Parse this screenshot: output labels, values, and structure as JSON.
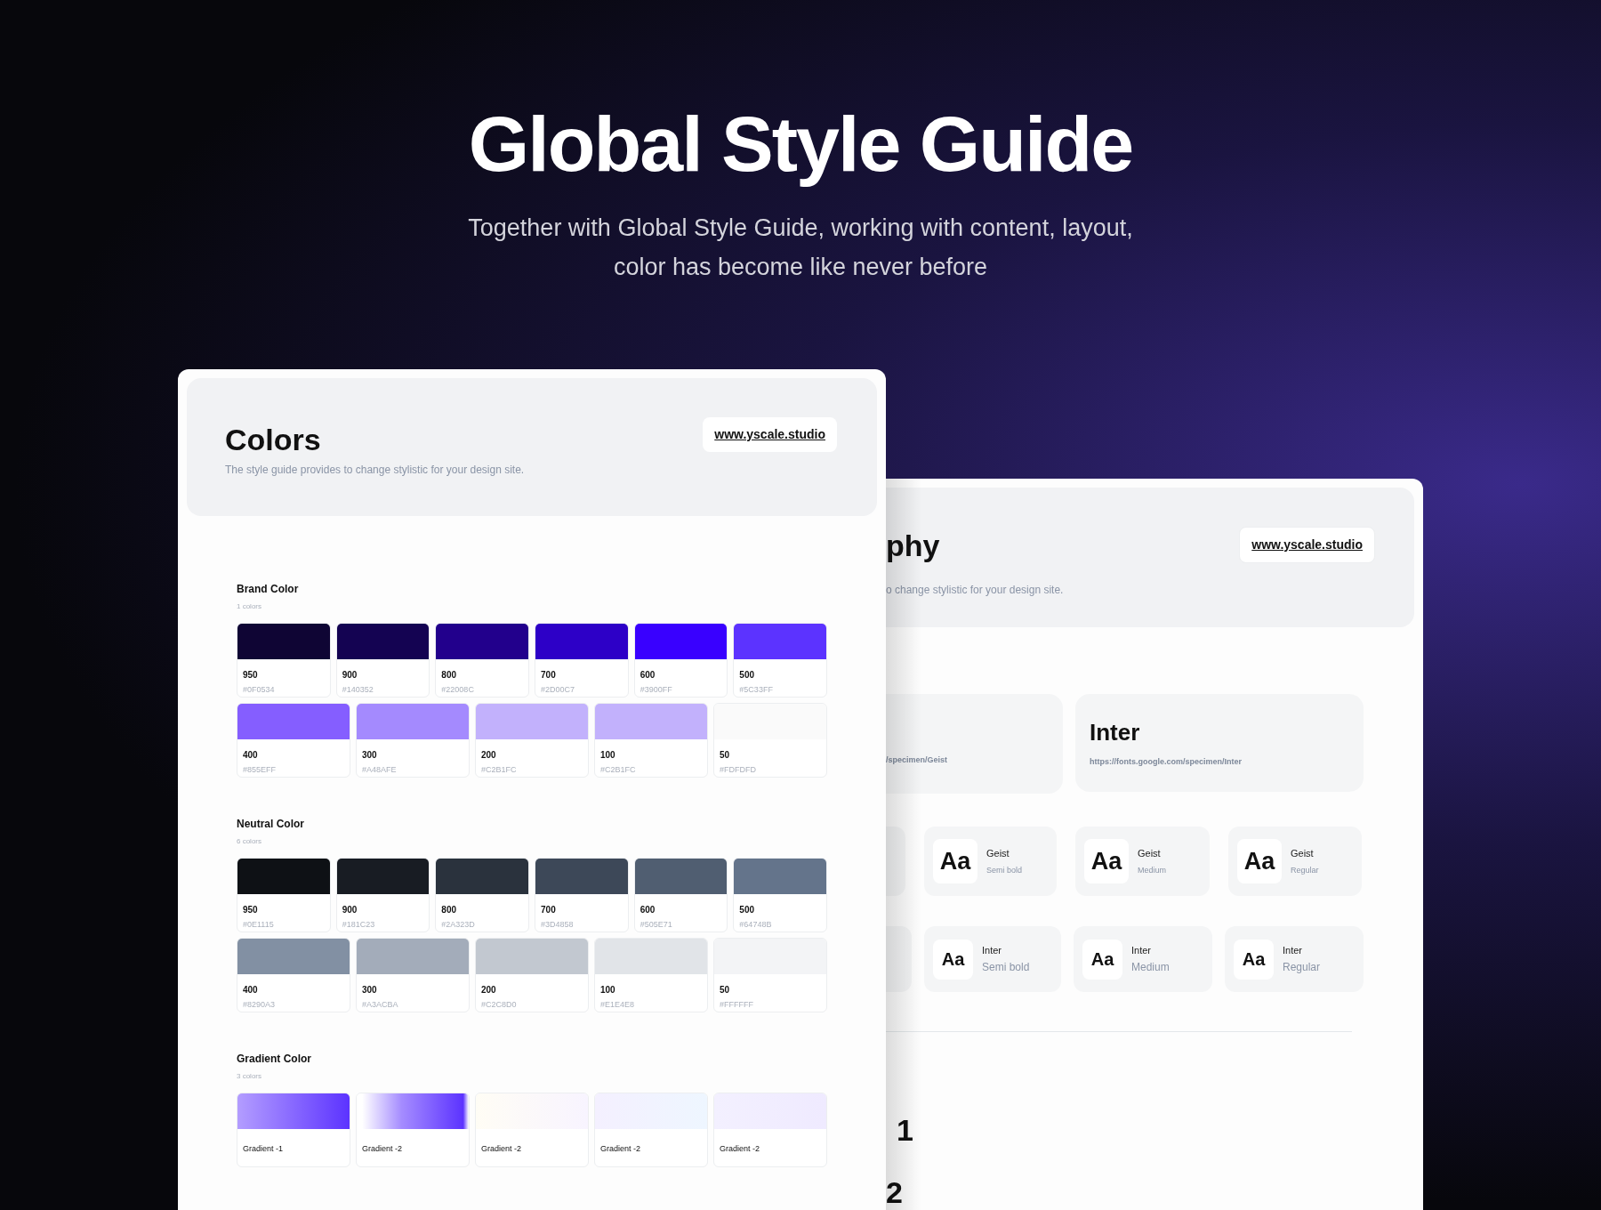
{
  "hero": {
    "title": "Global Style Guide",
    "subtitle": "Together with Global Style Guide, working with content, layout, color has become like never before"
  },
  "colors_page": {
    "title": "Colors",
    "link": "www.yscale.studio",
    "description": "The style guide provides to change stylistic for your design site.",
    "sections": [
      {
        "title": "Brand Color",
        "count": "1 colors",
        "kind": "solid",
        "rows": [
          [
            {
              "name": "950",
              "hex": "#0F0534",
              "color": "#0f0534"
            },
            {
              "name": "900",
              "hex": "#140352",
              "color": "#140352"
            },
            {
              "name": "800",
              "hex": "#22008C",
              "color": "#22008c"
            },
            {
              "name": "700",
              "hex": "#2D00C7",
              "color": "#2d00c7"
            },
            {
              "name": "600",
              "hex": "#3900FF",
              "color": "#3900ff"
            },
            {
              "name": "500",
              "hex": "#5C33FF",
              "color": "#5c33ff"
            }
          ],
          [
            {
              "name": "400",
              "hex": "#855EFF",
              "color": "#855eff"
            },
            {
              "name": "300",
              "hex": "#A48AFE",
              "color": "#a48afe"
            },
            {
              "name": "200",
              "hex": "#C2B1FC",
              "color": "#c2b1fc"
            },
            {
              "name": "100",
              "hex": "#C2B1FC",
              "color": "#c2b1fc"
            },
            {
              "name": "50",
              "hex": "#FDFDFD",
              "color": "#fafafa"
            }
          ]
        ]
      },
      {
        "title": "Neutral Color",
        "count": "6 colors",
        "kind": "solid",
        "rows": [
          [
            {
              "name": "950",
              "hex": "#0E1115",
              "color": "#0e1115"
            },
            {
              "name": "900",
              "hex": "#181C23",
              "color": "#181c23"
            },
            {
              "name": "800",
              "hex": "#2A323D",
              "color": "#2a323d"
            },
            {
              "name": "700",
              "hex": "#3D4858",
              "color": "#3d4858"
            },
            {
              "name": "600",
              "hex": "#505E71",
              "color": "#505e71"
            },
            {
              "name": "500",
              "hex": "#64748B",
              "color": "#64748b"
            }
          ],
          [
            {
              "name": "400",
              "hex": "#8290A3",
              "color": "#8290a3"
            },
            {
              "name": "300",
              "hex": "#A3ACBA",
              "color": "#a3acba"
            },
            {
              "name": "200",
              "hex": "#C2C8D0",
              "color": "#c2c8d0"
            },
            {
              "name": "100",
              "hex": "#E1E4E8",
              "color": "#e1e4e8"
            },
            {
              "name": "50",
              "hex": "#FFFFFF",
              "color": "#f3f4f6"
            }
          ]
        ]
      },
      {
        "title": "Gradient Color",
        "count": "3 colors",
        "kind": "gradient",
        "rows": [
          [
            {
              "name": "Gradient -1"
            },
            {
              "name": "Gradient -2"
            },
            {
              "name": "Gradient -2"
            },
            {
              "name": "Gradient -2"
            },
            {
              "name": "Gradient -2"
            }
          ]
        ]
      }
    ]
  },
  "typography_page": {
    "title": "phy",
    "link": "www.yscale.studio",
    "description": "o change stylistic for your design site.",
    "fonts": [
      {
        "url": "/specimen/Geist"
      },
      {
        "name": "Inter",
        "url": "https://fonts.google.com/specimen/Inter"
      }
    ],
    "geist_styles": [
      {
        "sample": "Aa",
        "family": "Geist",
        "weight": "Semi bold"
      },
      {
        "sample": "Aa",
        "family": "Geist",
        "weight": "Medium"
      },
      {
        "sample": "Aa",
        "family": "Geist",
        "weight": "Regular"
      }
    ],
    "inter_styles": [
      {
        "sample": "Aa",
        "family": "Inter",
        "weight": "Semi bold"
      },
      {
        "sample": "Aa",
        "family": "Inter",
        "weight": "Medium"
      },
      {
        "sample": "Aa",
        "family": "Inter",
        "weight": "Regular"
      }
    ],
    "headings": [
      "1",
      "2"
    ]
  }
}
